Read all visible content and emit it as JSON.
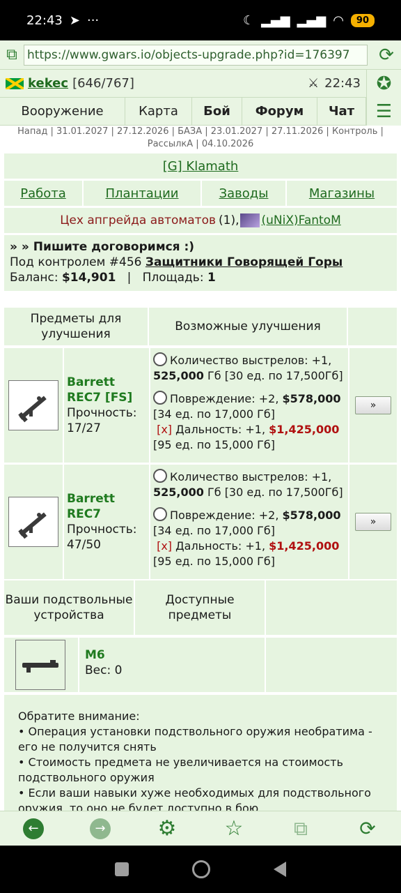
{
  "status_bar": {
    "time": "22:43",
    "battery": "90"
  },
  "browser": {
    "url": "https://www.gwars.io/objects-upgrade.php?id=176397"
  },
  "user": {
    "nick": "kekec",
    "hp": "[646/767]",
    "time": "22:43"
  },
  "menu": [
    "Вооружение",
    "Карта",
    "Бой",
    "Форум",
    "Чат"
  ],
  "dates_line": "Напад | 31.01.2027 | 27.12.2026 | БАЗА | 23.01.2027 | 27.11.2026 | Контроль | РассылкА | 04.10.2026",
  "sector": {
    "title": "[G] Klamath"
  },
  "subnav": [
    "Работа",
    "Плантации",
    "Заводы",
    "Магазины"
  ],
  "workshop": {
    "name": "Цех апгрейда автоматов",
    "count": "(1),",
    "owner": "(uNiX)FantoM"
  },
  "info": {
    "line1": "» » Пишите договоримся :)",
    "controlled_prefix": "Под контролем #456",
    "controlled_by": "Защитники Говорящей Горы",
    "balance_label": "Баланс:",
    "balance": "$14,901",
    "area_label": "Площадь:",
    "area": "1"
  },
  "upgrade_table": {
    "col1": "Предметы для улучшения",
    "col2": "Возможные улучшения",
    "rows": [
      {
        "name": "Barrett REC7 [FS]",
        "durability_label": "Прочность:",
        "durability": "17/27",
        "opt1_label": "Количество выстрелов: +1,",
        "opt1_price": "525,000",
        "opt1_unit": "Гб",
        "opt1_detail": "[30 ед. по 17,500Гб]",
        "opt2_label": "Повреждение: +2,",
        "opt2_price": "$578,000",
        "opt2_detail": "[34 ед. по 17,000 Гб]",
        "opt3_mark": "[x]",
        "opt3_label": "Дальность: +1,",
        "opt3_price": "$1,425,000",
        "opt3_detail": "[95 ед. по 15,000 Гб]",
        "button": "»"
      },
      {
        "name": "Barrett REC7",
        "durability_label": "Прочность:",
        "durability": "47/50",
        "opt1_label": "Количество выстрелов: +1,",
        "opt1_price": "525,000",
        "opt1_unit": "Гб",
        "opt1_detail": "[30 ед. по 17,500Гб]",
        "opt2_label": "Повреждение: +2,",
        "opt2_price": "$578,000",
        "opt2_detail": "[34 ед. по 17,000 Гб]",
        "opt3_mark": "[x]",
        "opt3_label": "Дальность: +1,",
        "opt3_price": "$1,425,000",
        "opt3_detail": "[95 ед. по 15,000 Гб]",
        "button": "»"
      }
    ]
  },
  "underbarrel": {
    "col1": "Ваши подствольные устройства",
    "col2": "Доступные предметы",
    "item_name": "M6",
    "item_weight": "Вес: 0"
  },
  "notice": {
    "title": "Обратите внимание:",
    "items": [
      "• Операция установки подствольного оружия необратима - его не получится снять",
      "• Стоимость предмета не увеличивается на стоимость подствольного оружия",
      "• Если ваши навыки хуже необходимых для подствольного оружия, то оно не будет доступно в бою"
    ]
  }
}
